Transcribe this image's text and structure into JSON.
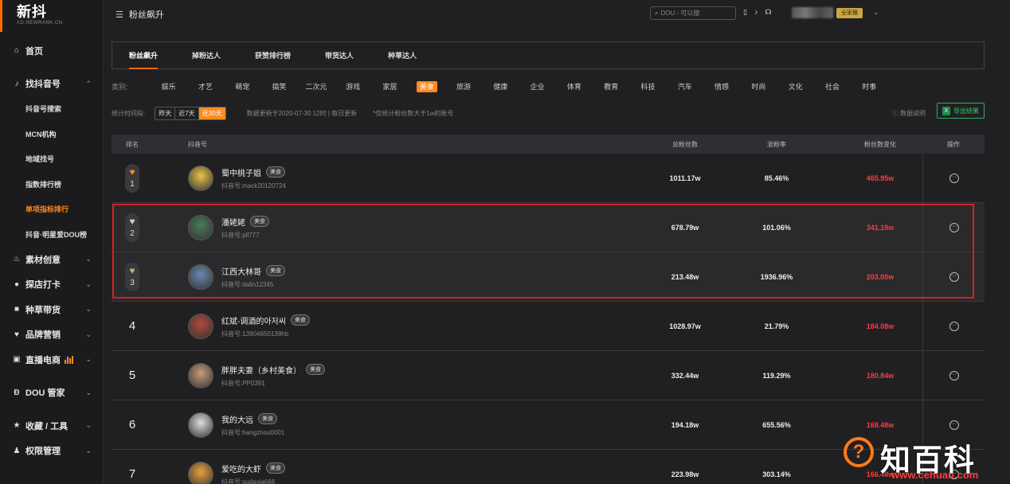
{
  "brand": {
    "name": "新抖",
    "sub": "XD.NEWRANK.CN",
    "accent": "#ff8a1f"
  },
  "sidebar": {
    "home": "首页",
    "find": "找抖音号",
    "subs": [
      "抖音号搜索",
      "MCN机构",
      "地域找号",
      "指数排行榜",
      "单项指标排行",
      "抖音·明星爱DOU榜"
    ],
    "groups": [
      "素材创意",
      "探店打卡",
      "种草带货",
      "品牌营销",
      "直播电商"
    ],
    "dou": "DOU 管家",
    "fav": "收藏 / 工具",
    "perm": "权限管理"
  },
  "topbar": {
    "title": "粉丝飙升",
    "search_placeholder": "DOU - 可以搜",
    "badge": "全家桶"
  },
  "tabs": [
    "粉丝飙升",
    "掉粉达人",
    "获赞排行榜",
    "带货达人",
    "种草达人"
  ],
  "filters": {
    "category_label": "类别:",
    "categories": [
      "娱乐",
      "才艺",
      "萌宠",
      "搞笑",
      "二次元",
      "游戏",
      "家居",
      "美食",
      "旅游",
      "健康",
      "企业",
      "体育",
      "教育",
      "科技",
      "汽车",
      "情感",
      "时尚",
      "文化",
      "社会",
      "时事"
    ],
    "time_label": "统计时间段:",
    "time_options": [
      "昨天",
      "近7天",
      "近30天"
    ],
    "update_text": "数据更新于2020-07-30 12时 | 每日更新",
    "note": "*仅统计粉丝数大于1w的账号",
    "help": "数据说明",
    "export": "导出结果"
  },
  "table": {
    "headers": {
      "rank": "排名",
      "account": "抖音号",
      "fans": "总粉丝数",
      "rate": "涨粉率",
      "change": "粉丝数变化",
      "op": "操作"
    },
    "rows": [
      {
        "rank": "1",
        "name": "蜀中桃子姐",
        "tag": "美食",
        "id": "抖音号:mack20120724",
        "fans": "1011.17w",
        "rate": "85.46%",
        "change": "465.95w"
      },
      {
        "rank": "2",
        "name": "潘姥姥",
        "tag": "美食",
        "id": "抖音号:pll777",
        "fans": "678.79w",
        "rate": "101.06%",
        "change": "341.19w"
      },
      {
        "rank": "3",
        "name": "江西大林哥",
        "tag": "美食",
        "id": "抖音号:dalin12345",
        "fans": "213.48w",
        "rate": "1936.96%",
        "change": "203.00w"
      },
      {
        "rank": "4",
        "name": "红斌-调酒的아저씨",
        "tag": "美食",
        "id": "抖音号:13904650138hb",
        "fans": "1028.97w",
        "rate": "21.79%",
        "change": "184.08w"
      },
      {
        "rank": "5",
        "name": "胖胖夫妻（乡村美食）",
        "tag": "美食",
        "id": "抖音号:PP0391",
        "fans": "332.44w",
        "rate": "119.29%",
        "change": "180.84w"
      },
      {
        "rank": "6",
        "name": "我的大远",
        "tag": "美食",
        "id": "抖音号:hangzhou0001",
        "fans": "194.18w",
        "rate": "655.56%",
        "change": "168.48w"
      },
      {
        "rank": "7",
        "name": "爱吃的大虾",
        "tag": "美食",
        "id": "抖音号:sudaxia666",
        "fans": "223.98w",
        "rate": "303.14%",
        "change": "166.48w"
      }
    ]
  },
  "watermark": {
    "text": "知百科",
    "url": "www.cehuan.com"
  }
}
